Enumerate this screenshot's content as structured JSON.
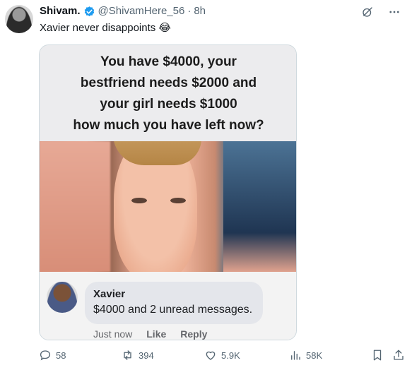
{
  "tweet": {
    "author_name": "Shivam.",
    "handle": "@ShivamHere_56",
    "separator": "·",
    "time": "8h",
    "text": "Xavier never disappoints 😂"
  },
  "meme": {
    "caption_lines": [
      "You have $4000, your",
      "bestfriend needs $2000 and",
      "your girl needs $1000",
      "how much you have left now?"
    ],
    "comment": {
      "name": "Xavier",
      "text": "$4000 and 2 unread messages.",
      "time": "Just now",
      "like": "Like",
      "reply": "Reply"
    }
  },
  "actions": {
    "replies": "58",
    "reposts": "394",
    "likes": "5.9K",
    "views": "58K"
  },
  "icons": [
    "grok-icon",
    "more-icon",
    "reply-icon",
    "repost-icon",
    "like-icon",
    "views-icon",
    "bookmark-icon",
    "share-icon"
  ],
  "colors": {
    "verified": "#1d9bf0",
    "muted": "#536471"
  }
}
